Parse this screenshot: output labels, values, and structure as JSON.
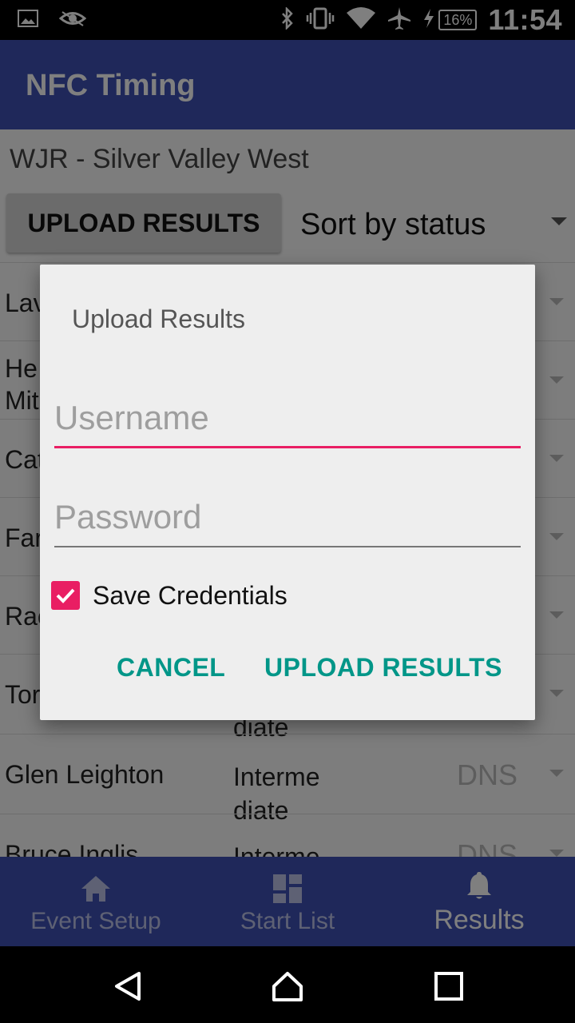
{
  "status_bar": {
    "time": "11:54",
    "battery": "16%",
    "icons": [
      "image-icon",
      "eye-icon",
      "bluetooth-icon",
      "vibrate-icon",
      "wifi-icon",
      "airplane-icon",
      "charging-icon"
    ]
  },
  "app_bar": {
    "title": "NFC Timing"
  },
  "content": {
    "event_name": "WJR - Silver Valley West",
    "upload_button": "UPLOAD RESULTS",
    "sort_select": "Sort by status",
    "rows": [
      {
        "name": "Lav",
        "category": "",
        "status": ""
      },
      {
        "name": "He\nMit",
        "category": "",
        "status": ""
      },
      {
        "name": "Cat",
        "category": "",
        "status": ""
      },
      {
        "name": "Far",
        "category": "",
        "status": ""
      },
      {
        "name": "Rac",
        "category": "",
        "status": ""
      },
      {
        "name": "Tor",
        "category": "diate",
        "status": ""
      },
      {
        "name": "Glen Leighton",
        "category": "Interme\ndiate",
        "status": "DNS"
      },
      {
        "name": "Bruce Inglis",
        "category": "Interme",
        "status": "DNS"
      }
    ]
  },
  "dialog": {
    "title": "Upload Results",
    "username_placeholder": "Username",
    "password_placeholder": "Password",
    "save_credentials_label": "Save Credentials",
    "save_credentials_checked": true,
    "cancel_label": "CANCEL",
    "confirm_label": "UPLOAD RESULTS"
  },
  "bottom_nav": {
    "items": [
      {
        "label": "Event Setup",
        "icon": "home-icon",
        "active": false
      },
      {
        "label": "Start List",
        "icon": "dashboard-icon",
        "active": false
      },
      {
        "label": "Results",
        "icon": "bell-icon",
        "active": true
      }
    ]
  },
  "colors": {
    "primary": "#3f51b5",
    "accent": "#e91e63",
    "dialog_button": "#009688"
  }
}
